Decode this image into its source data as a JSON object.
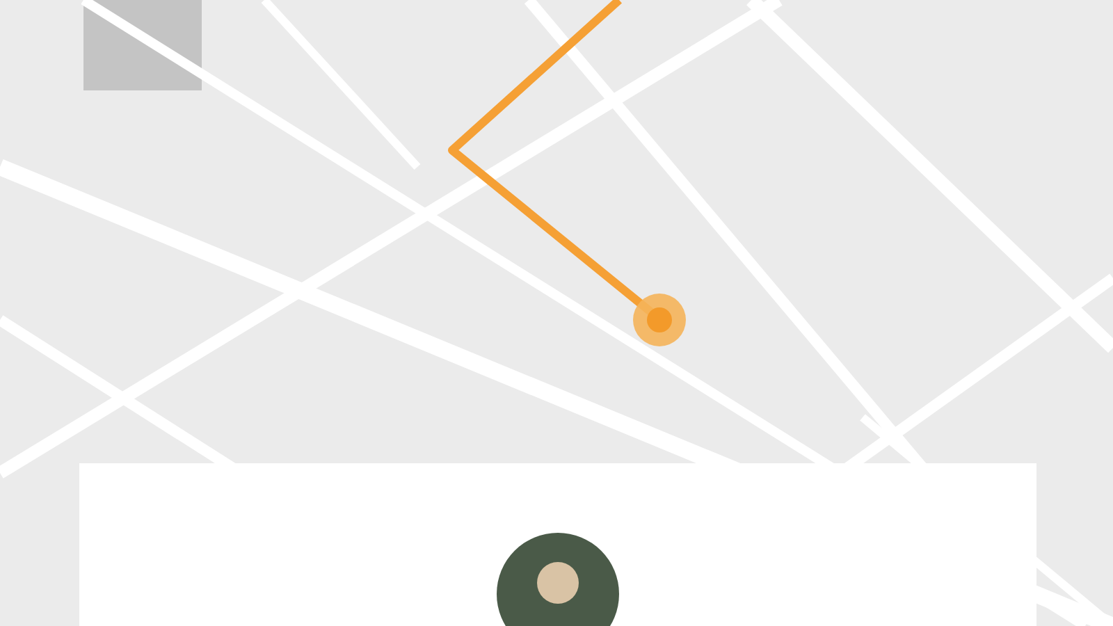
{
  "route": {
    "kind": "route"
  },
  "card": {
    "avatar": {
      "kind": "avatar"
    }
  }
}
